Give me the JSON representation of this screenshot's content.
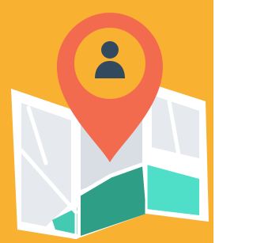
{
  "illustration": {
    "subject": "location-pin-on-map",
    "icons": [
      "map-icon",
      "location-pin-icon",
      "user-icon"
    ],
    "colors": {
      "background": "#F9B132",
      "map_frame": "#FFFFFF",
      "map_panel_light": "#E6E9EE",
      "map_panel_mid": "#D9DDE4",
      "road": "#FFFFFF",
      "terrain_dark": "#2E9E86",
      "terrain_light": "#4FDEC8",
      "terrain_mid": "#44C9B2",
      "pin": "#F26B4F",
      "pin_inner_circle": "#F9B132",
      "user_silhouette": "#334A5E"
    }
  }
}
